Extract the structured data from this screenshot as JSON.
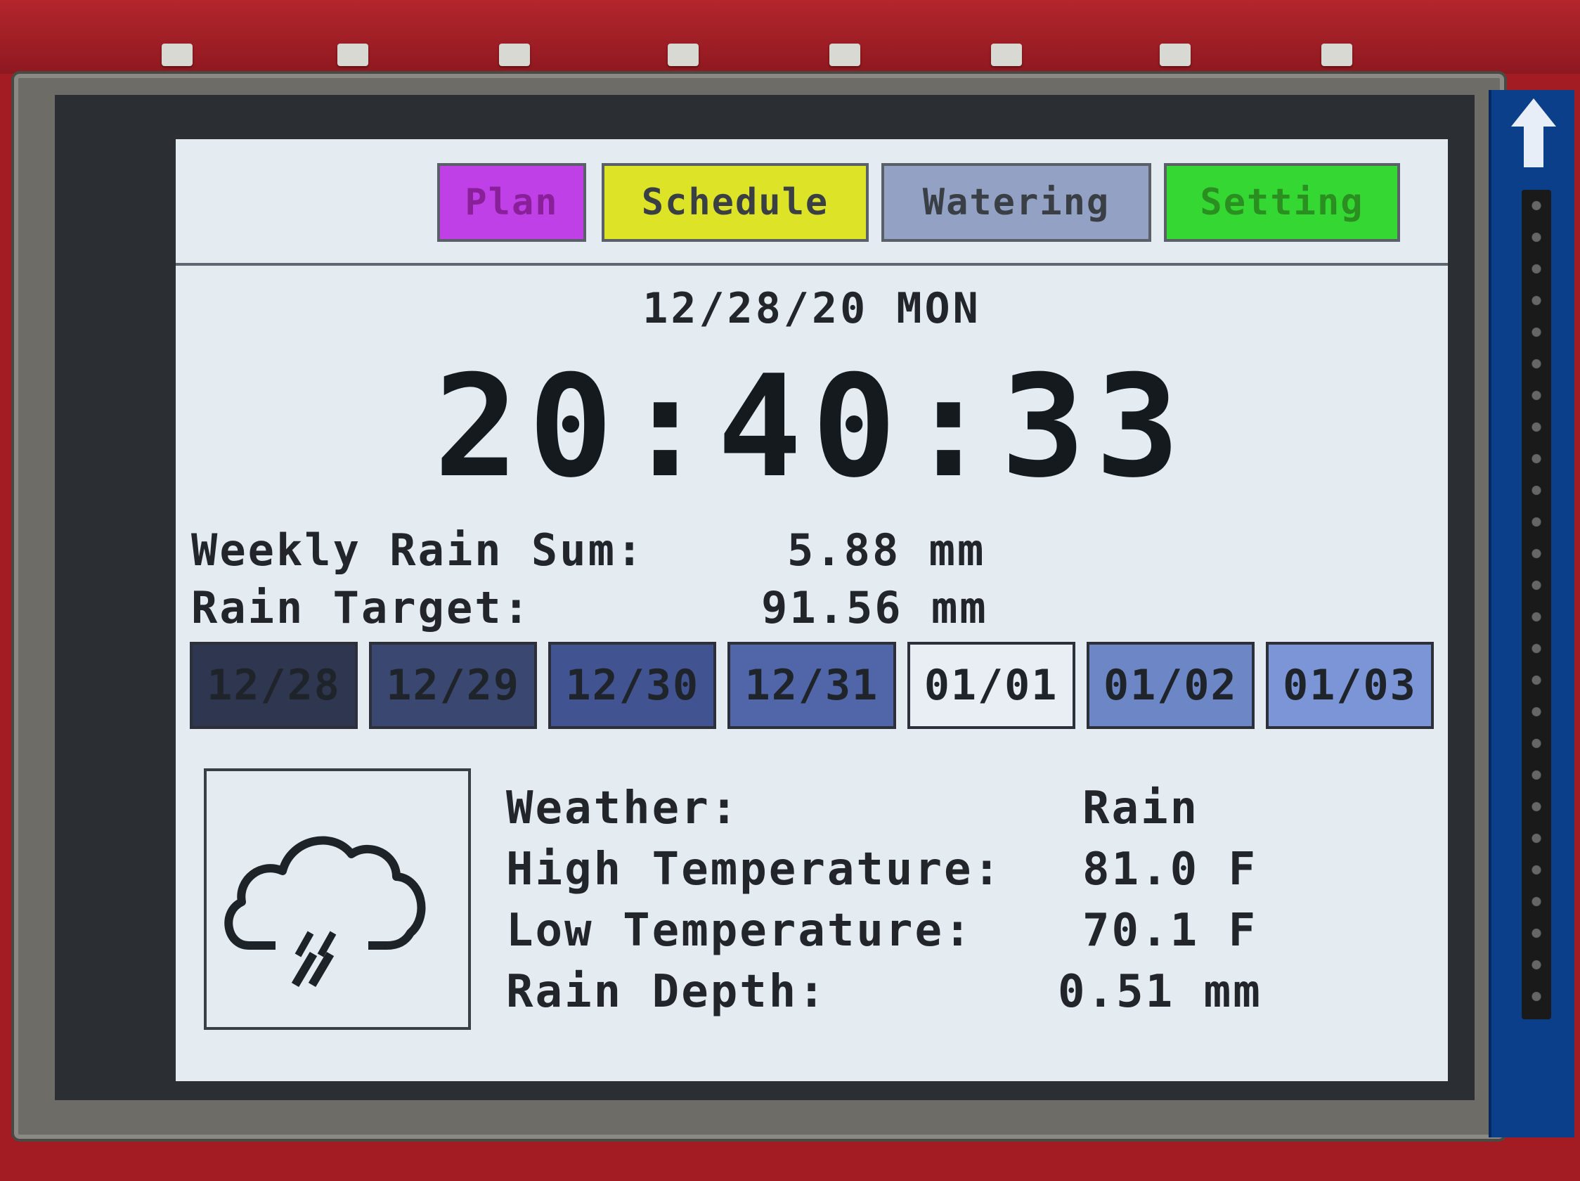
{
  "tabs": {
    "plan": "Plan",
    "schedule": "Schedule",
    "watering": "Watering",
    "setting": "Setting"
  },
  "date": "12/28/20 MON",
  "time": "20:40:33",
  "rain": {
    "weekly_label": "Weekly Rain Sum:",
    "weekly_value": "5.88 mm",
    "target_label": "Rain Target:",
    "target_value": "91.56 mm"
  },
  "days": [
    {
      "label": "12/28",
      "color": "#2e3650"
    },
    {
      "label": "12/29",
      "color": "#3a4770"
    },
    {
      "label": "12/30",
      "color": "#415390"
    },
    {
      "label": "12/31",
      "color": "#5066a8"
    },
    {
      "label": "01/01",
      "color": "#e9eef4"
    },
    {
      "label": "01/02",
      "color": "#6d86c6"
    },
    {
      "label": "01/03",
      "color": "#7b95d6"
    }
  ],
  "weather": {
    "icon": "cloud-rain-icon",
    "weather_label": "Weather:",
    "weather_value": "Rain",
    "high_label": "High Temperature:",
    "high_value": "81.0 F",
    "low_label": "Low Temperature:",
    "low_value": "70.1 F",
    "depth_label": "Rain Depth:",
    "depth_value": "0.51 mm"
  }
}
